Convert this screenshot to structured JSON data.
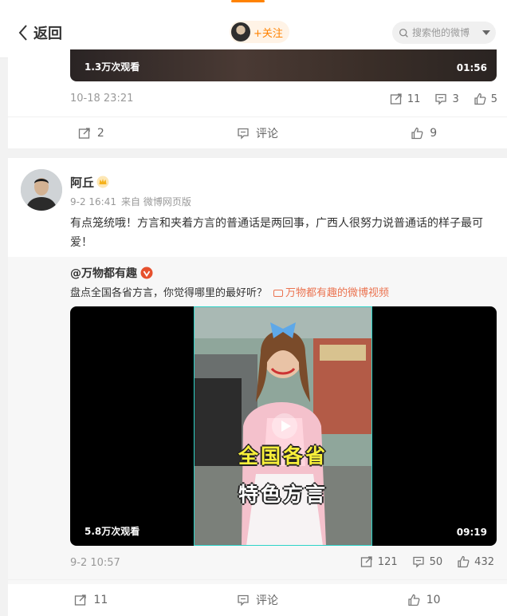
{
  "nav": {
    "back_label": "返回",
    "follow_label": "+关注",
    "search_placeholder": "搜索他的微博"
  },
  "post1": {
    "video_views": "1.3万次观看",
    "video_duration": "01:56",
    "timestamp": "10-18 23:21",
    "forward_count": "11",
    "comment_count": "3",
    "like_count": "5",
    "actions": {
      "forward": "2",
      "comment": "评论",
      "like": "9"
    }
  },
  "post2": {
    "username": "阿丘",
    "time": "9-2 16:41",
    "source": "来自 微博网页版",
    "text": "有点笼统哦！方言和夹着方言的普通话是两回事，广西人很努力说普通话的样子最可爱！",
    "repost": {
      "author": "@万物都有趣",
      "text": "盘点全国各省方言，你觉得哪里的最好听？",
      "link_text": "万物都有趣的微博视频",
      "video_caption_line1": "全国各省",
      "video_caption_line2": "特色方言",
      "video_views": "5.8万次观看",
      "video_duration": "09:19",
      "timestamp": "9-2 10:57",
      "forward_count": "121",
      "comment_count": "50",
      "like_count": "432"
    },
    "actions": {
      "forward": "11",
      "comment": "评论",
      "like": "10"
    }
  },
  "colors": {
    "accent": "#ff8200",
    "link": "#eb7350",
    "verify": "#e6502d",
    "crown": "#f5b21c"
  }
}
